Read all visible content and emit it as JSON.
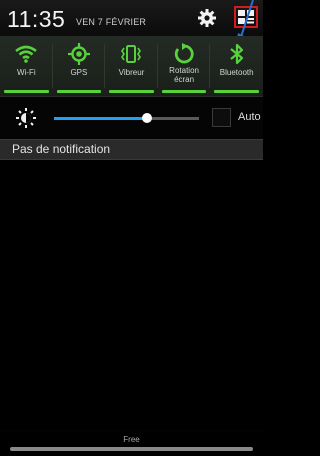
{
  "status": {
    "time": "11:35",
    "date": "VEN 7 FÉVRIER"
  },
  "header_icons": {
    "settings": "gear-icon",
    "panel": "quick-panel-grid-icon"
  },
  "quick_toggles": [
    {
      "label": "Wi-Fi",
      "icon": "wifi-icon",
      "active": true
    },
    {
      "label": "GPS",
      "icon": "gps-icon",
      "active": true
    },
    {
      "label": "Vibreur",
      "icon": "vibrate-icon",
      "active": true
    },
    {
      "label": "Rotation\nécran",
      "icon": "rotation-icon",
      "active": true
    },
    {
      "label": "Bluetooth",
      "icon": "bluetooth-icon",
      "active": true
    }
  ],
  "brightness": {
    "level": 0.64,
    "auto_label": "Auto",
    "auto_checked": false
  },
  "notifications": {
    "header": "Pas de notification"
  },
  "footer": {
    "carrier": "Free"
  },
  "colors": {
    "toggle_active": "#58d23c",
    "slider": "#23a0f0",
    "highlight_box": "#d01c1c",
    "arrow": "#2a6fd6"
  }
}
